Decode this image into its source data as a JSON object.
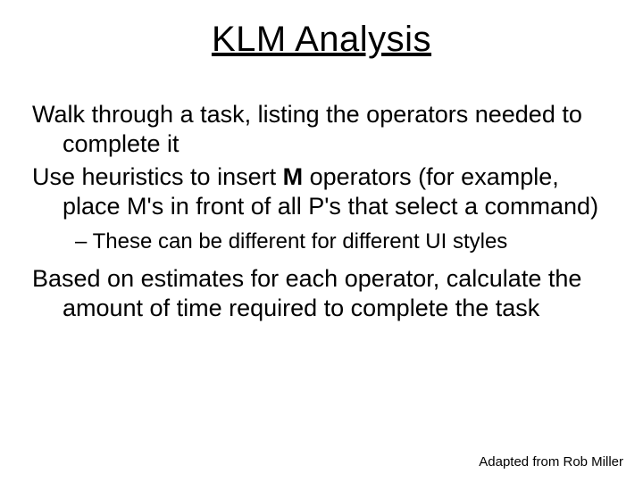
{
  "title": "KLM Analysis",
  "bullets": {
    "b1": "Walk through a task, listing the operators needed to complete it",
    "b2_pre": "Use heuristics to insert ",
    "b2_bold": "M",
    "b2_post": " operators (for example, place M's in front of all P's that select a command)",
    "b2_sub_prefix": "– ",
    "b2_sub": "These can be different for different UI styles",
    "b3": "Based on estimates for each operator, calculate the amount of time required to complete the task"
  },
  "attribution": "Adapted from Rob Miller"
}
